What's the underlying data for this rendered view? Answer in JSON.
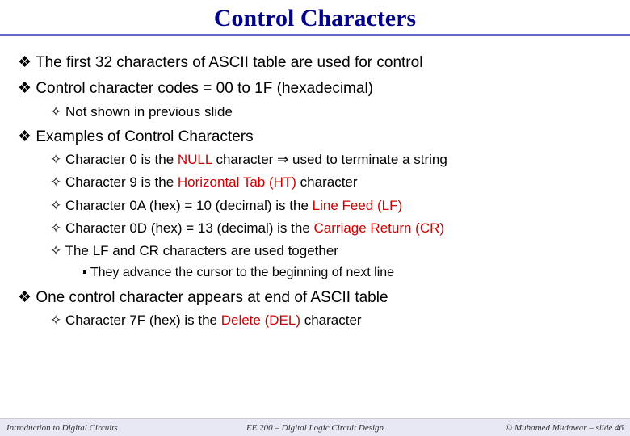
{
  "title": "Control Characters",
  "bullets": {
    "b1": "The first 32 characters of ASCII table are used for control",
    "b2": "Control character codes = 00 to 1F (hexadecimal)",
    "b2_1": "Not shown in previous slide",
    "b3": "Examples of Control Characters",
    "b3_1_a": "Character 0 is the ",
    "b3_1_hl": "NULL",
    "b3_1_b": " character ",
    "b3_1_arrow": "⇒",
    "b3_1_c": " used to terminate a string",
    "b3_2_a": "Character 9 is the ",
    "b3_2_hl": "Horizontal Tab (HT)",
    "b3_2_b": " character",
    "b3_3_a": "Character 0A (hex) = 10 (decimal) is the ",
    "b3_3_hl": "Line Feed (LF)",
    "b3_4_a": "Character 0D (hex) = 13 (decimal) is the ",
    "b3_4_hl": "Carriage Return (CR)",
    "b3_5": "The LF and CR characters are used together",
    "b3_5_1": "They advance the cursor to the beginning of next line",
    "b4": "One control character appears at end of ASCII table",
    "b4_1_a": "Character 7F (hex) is the ",
    "b4_1_hl": "Delete (DEL)",
    "b4_1_b": " character"
  },
  "footer": {
    "left": "Introduction to Digital Circuits",
    "center": "EE 200 – Digital Logic Circuit Design",
    "right": "© Muhamed Mudawar – slide 46"
  }
}
